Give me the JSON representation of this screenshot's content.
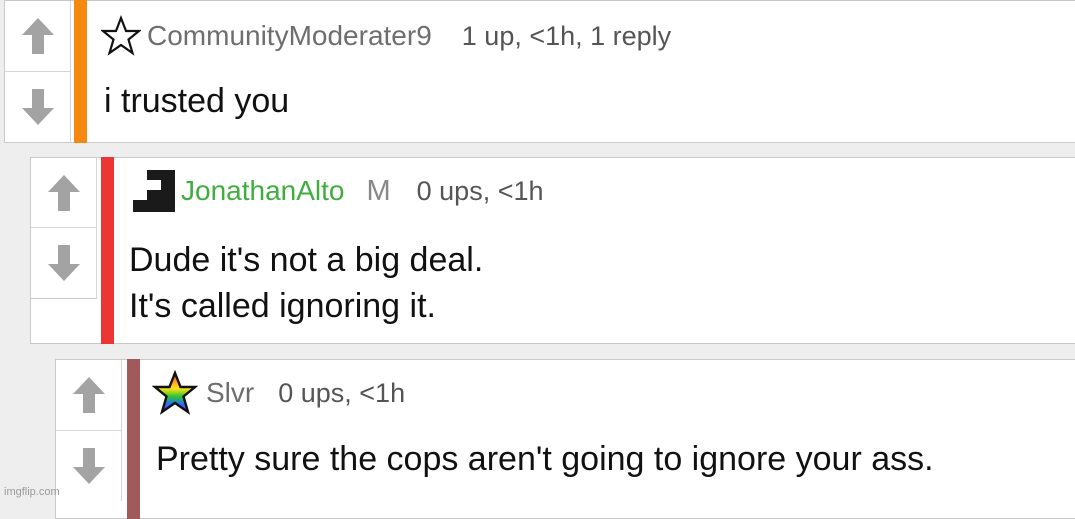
{
  "comments": [
    {
      "username": "CommunityModerater9",
      "username_color": "#6e6e6e",
      "avatar_icon": "star-outline-icon",
      "meta": "1 up, <1h, 1 reply",
      "text_lines": [
        "i trusted you"
      ],
      "accent_color": "#f5890f"
    },
    {
      "username": "JonathanAlto",
      "username_color": "#3fae3f",
      "avatar_icon": "pixel-blocks-icon",
      "mod_badge": "M",
      "meta": "0 ups, <1h",
      "text_lines": [
        "Dude it's not a big deal.",
        "It's called ignoring it."
      ],
      "accent_color": "#ee3535"
    },
    {
      "username": "Slvr",
      "username_color": "#6e6e6e",
      "avatar_icon": "rainbow-star-icon",
      "meta": "0 ups, <1h",
      "text_lines": [
        "Pretty sure the cops aren't going to ignore your ass."
      ],
      "accent_color": "#a05a5a"
    }
  ],
  "vote_up_icon": "arrow-up-icon",
  "vote_down_icon": "arrow-down-icon",
  "watermark": "imgflip.com"
}
